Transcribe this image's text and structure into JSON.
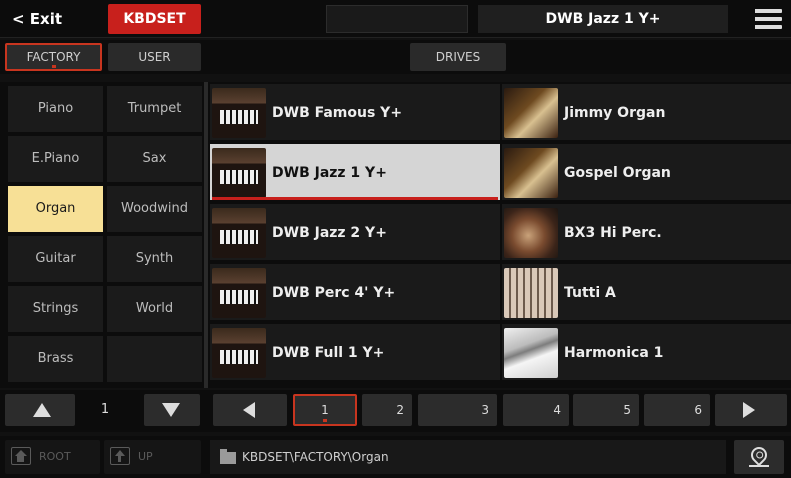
{
  "topbar": {
    "exit_label": "< Exit",
    "mode_tab": "KBDSET",
    "current_sound": "DWB Jazz 1 Y+",
    "accent_color": "#c8201c"
  },
  "tabs": {
    "factory": "FACTORY",
    "user": "USER",
    "drives": "DRIVES"
  },
  "categories": [
    {
      "left": "Piano",
      "right": "Trumpet"
    },
    {
      "left": "E.Piano",
      "right": "Sax"
    },
    {
      "left": "Organ",
      "right": "Woodwind"
    },
    {
      "left": "Guitar",
      "right": "Synth"
    },
    {
      "left": "Strings",
      "right": "World"
    },
    {
      "left": "Brass",
      "right": ""
    }
  ],
  "selected_category": "Organ",
  "sounds": [
    {
      "name": "DWB Famous Y+",
      "icon": "organ-console-icon"
    },
    {
      "name": "Jimmy Organ",
      "icon": "organ-keys-icon"
    },
    {
      "name": "DWB Jazz 1 Y+",
      "icon": "organ-console-icon"
    },
    {
      "name": "Gospel Organ",
      "icon": "organ-keys-icon"
    },
    {
      "name": "DWB Jazz 2 Y+",
      "icon": "organ-console-icon"
    },
    {
      "name": "BX3 Hi Perc.",
      "icon": "rotary-speaker-icon"
    },
    {
      "name": "DWB Perc 4' Y+",
      "icon": "organ-console-icon"
    },
    {
      "name": "Tutti A",
      "icon": "organ-pipes-icon"
    },
    {
      "name": "DWB Full 1 Y+",
      "icon": "organ-console-icon"
    },
    {
      "name": "Harmonica 1",
      "icon": "harmonica-icon"
    }
  ],
  "selected_sound": "DWB Jazz 1 Y+",
  "category_page": "1",
  "pages": [
    "1",
    "2",
    "3",
    "4",
    "5",
    "6"
  ],
  "current_page": "1",
  "bottom": {
    "root_label": "ROOT",
    "up_label": "UP",
    "path": "KBDSET\\FACTORY\\Organ"
  }
}
